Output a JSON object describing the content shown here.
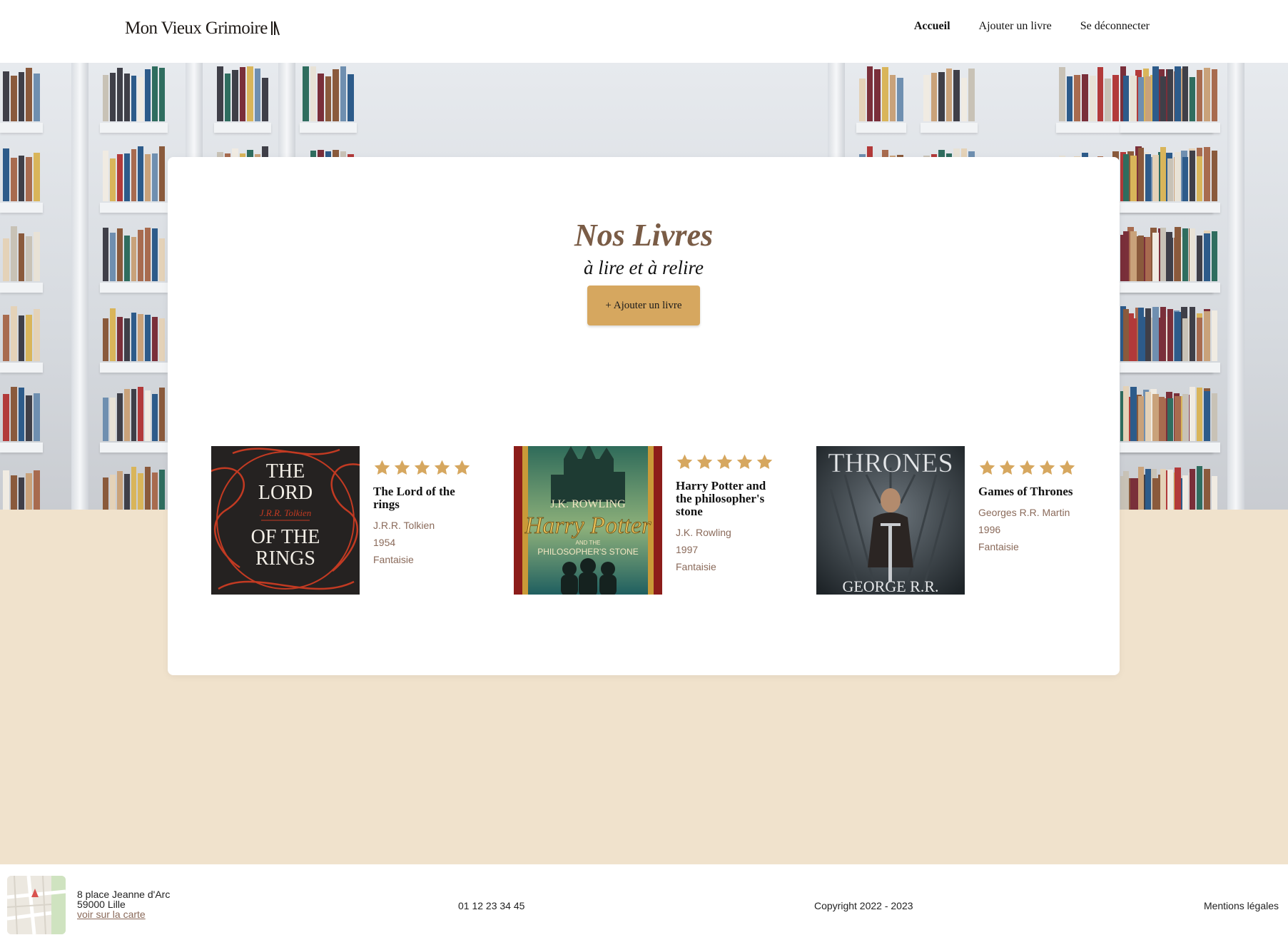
{
  "header": {
    "logo_text": "Mon Vieux Grimoire",
    "nav": [
      {
        "label": "Accueil",
        "active": true
      },
      {
        "label": "Ajouter un livre",
        "active": false
      },
      {
        "label": "Se déconnecter",
        "active": false
      }
    ]
  },
  "main": {
    "title": "Nos Livres",
    "subtitle": "à lire et à relire",
    "add_button": "+ Ajouter un livre"
  },
  "books": [
    {
      "title": "The Lord of the rings",
      "author": "J.R.R. Tolkien",
      "year": "1954",
      "genre": "Fantaisie",
      "rating": 5,
      "cover_lines": [
        "THE",
        "LORD",
        "OF THE",
        "RINGS"
      ],
      "cover_signature": "J.R.R. Tolkien"
    },
    {
      "title": "Harry Potter and the philosopher's stone",
      "author": "J.K. Rowling",
      "year": "1997",
      "genre": "Fantaisie",
      "rating": 5,
      "cover_lines": [
        "J.K. ROWLING",
        "Harry Potter",
        "AND THE",
        "PHILOSOPHER'S STONE"
      ]
    },
    {
      "title": "Games of Thrones",
      "author": "Georges R.R. Martin",
      "year": "1996",
      "genre": "Fantaisie",
      "rating": 5,
      "cover_lines": [
        "THRONES",
        "GEORGE R.R."
      ]
    }
  ],
  "footer": {
    "address_line1": "8 place Jeanne d'Arc",
    "address_line2": "59000 Lille",
    "map_link": "voir sur la carte",
    "phone": "01 12 23 34 45",
    "copyright": "Copyright 2022 - 2023",
    "legal": "Mentions légales"
  },
  "colors": {
    "accent": "#D6A75F",
    "beige": "#F0E2CC",
    "title_brown": "#7A5C46",
    "meta_brown": "#8A6A5A"
  }
}
